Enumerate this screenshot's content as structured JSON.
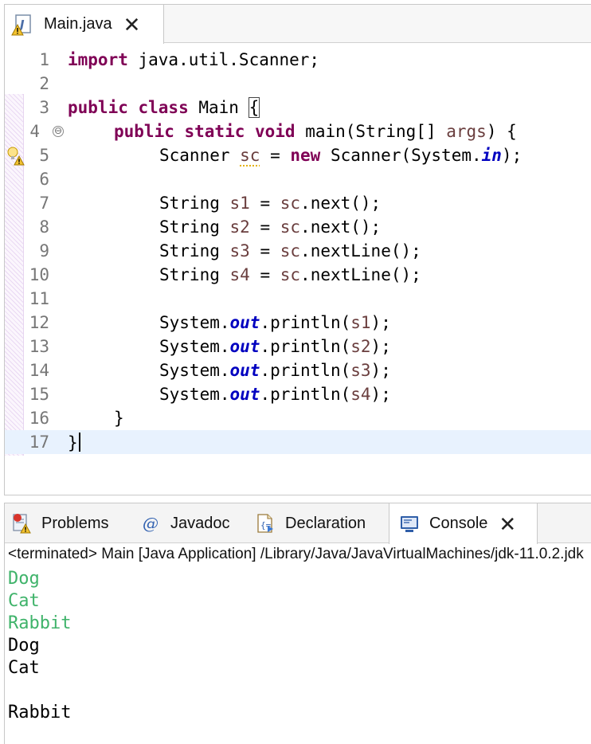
{
  "editor": {
    "tab": {
      "title": "Main.java",
      "close": "✕"
    },
    "lines": [
      {
        "n": "1"
      },
      {
        "n": "2"
      },
      {
        "n": "3"
      },
      {
        "n": "4"
      },
      {
        "n": "5"
      },
      {
        "n": "6"
      },
      {
        "n": "7"
      },
      {
        "n": "8"
      },
      {
        "n": "9"
      },
      {
        "n": "10"
      },
      {
        "n": "11"
      },
      {
        "n": "12"
      },
      {
        "n": "13"
      },
      {
        "n": "14"
      },
      {
        "n": "15"
      },
      {
        "n": "16"
      },
      {
        "n": "17"
      }
    ],
    "code": {
      "l1_kw": "import",
      "l1_rest": " java.util.Scanner;",
      "l3_kw": "public class",
      "l3_name": " Main ",
      "l3_brace": "{",
      "l4_kw": "public static void",
      "l4_rest": " main(String[] ",
      "l4_args": "args",
      "l4_end": ") {",
      "l5_a": "Scanner ",
      "l5_var": "sc",
      "l5_b": " = ",
      "l5_kw": "new",
      "l5_c": " Scanner(System.",
      "l5_fld": "in",
      "l5_d": ");",
      "l7_a": "String ",
      "l7_var": "s1",
      "l7_b": " = ",
      "l7_sc": "sc",
      "l7_c": ".next();",
      "l8_a": "String ",
      "l8_var": "s2",
      "l8_b": " = ",
      "l8_sc": "sc",
      "l8_c": ".next();",
      "l9_a": "String ",
      "l9_var": "s3",
      "l9_b": " = ",
      "l9_sc": "sc",
      "l9_c": ".nextLine();",
      "l10_a": "String ",
      "l10_var": "s4",
      "l10_b": " = ",
      "l10_sc": "sc",
      "l10_c": ".nextLine();",
      "print_a": "System.",
      "print_fld": "out",
      "print_b": ".println(",
      "print_end": ");",
      "l12_var": "s1",
      "l13_var": "s2",
      "l14_var": "s3",
      "l15_var": "s4",
      "l16": "}",
      "l17": "}"
    },
    "fold_glyph": "⊖"
  },
  "panel": {
    "tabs": [
      {
        "label": "Problems",
        "icon": "problems-icon"
      },
      {
        "label": "Javadoc",
        "icon": "at-icon",
        "glyph": "@"
      },
      {
        "label": "Declaration",
        "icon": "declaration-icon"
      },
      {
        "label": "Console",
        "icon": "console-icon",
        "active": true,
        "close": "✕"
      }
    ],
    "status": "<terminated> Main [Java Application] /Library/Java/JavaVirtualMachines/jdk-11.0.2.jdk",
    "console_lines": [
      {
        "text": "Dog",
        "kind": "input"
      },
      {
        "text": "Cat",
        "kind": "input"
      },
      {
        "text": "Rabbit",
        "kind": "input"
      },
      {
        "text": "Dog",
        "kind": "output"
      },
      {
        "text": "Cat",
        "kind": "output"
      },
      {
        "text": "",
        "kind": "output"
      },
      {
        "text": "Rabbit",
        "kind": "output"
      }
    ]
  },
  "colors": {
    "keyword": "#7f0055",
    "local_var": "#6a3e3e",
    "static_field": "#0000c0",
    "stdin_echo": "#3fb36a",
    "current_line": "#e8f2fe"
  }
}
